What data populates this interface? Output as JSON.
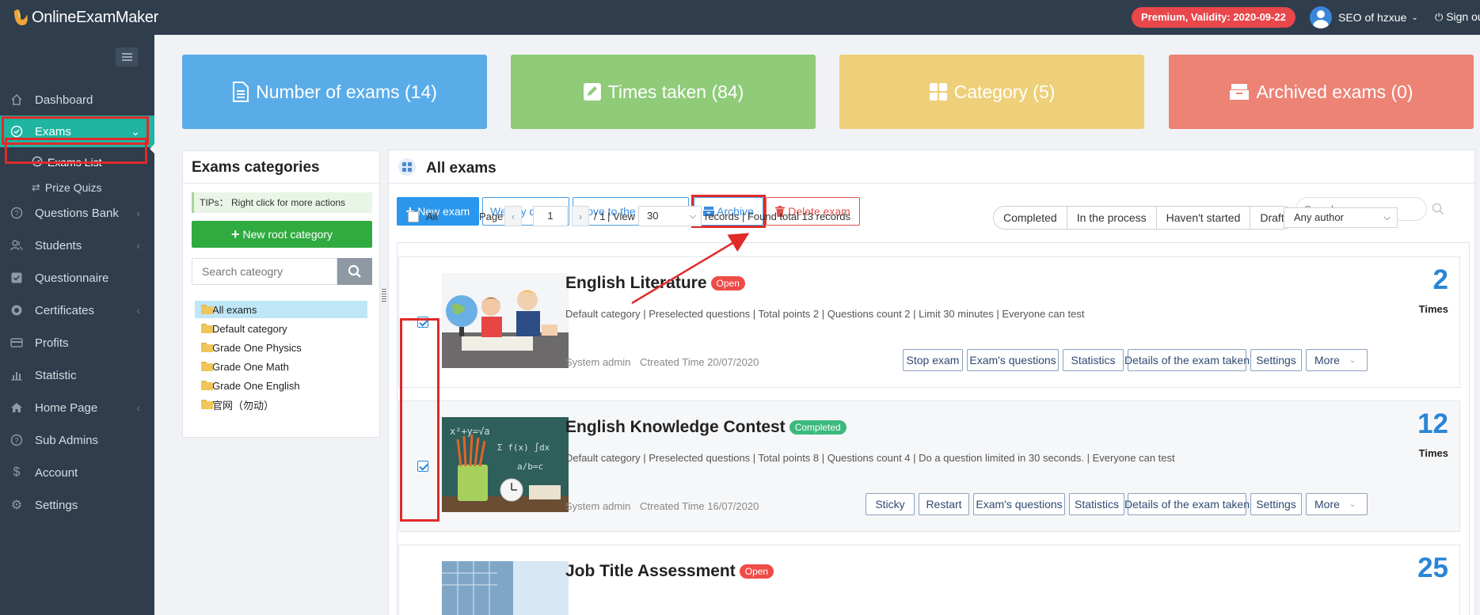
{
  "app": {
    "logo_text": "OnlineExamMaker"
  },
  "header": {
    "premium_badge": "Premium, Validity: 2020-09-22",
    "user_name": "SEO of hzxue",
    "signout_label": "Sign out"
  },
  "sidebar": {
    "items": [
      {
        "label": "Dashboard",
        "icon": "home-icon"
      },
      {
        "label": "Exams",
        "icon": "check-circle-icon"
      },
      {
        "label": "Questions Bank",
        "icon": "question-circle-icon"
      },
      {
        "label": "Students",
        "icon": "users-icon"
      },
      {
        "label": "Questionnaire",
        "icon": "check-square-icon"
      },
      {
        "label": "Certificates",
        "icon": "certificate-icon"
      },
      {
        "label": "Profits",
        "icon": "credit-card-icon"
      },
      {
        "label": "Statistic",
        "icon": "bar-chart-icon"
      },
      {
        "label": "Home Page",
        "icon": "home-page-icon"
      },
      {
        "label": "Sub Admins",
        "icon": "question-icon"
      },
      {
        "label": "Account",
        "icon": "dollar-icon"
      },
      {
        "label": "Settings",
        "icon": "gear-icon"
      }
    ],
    "sub_items": [
      {
        "label": "Exams List",
        "icon": "check-circle-icon"
      },
      {
        "label": "Prize Quizs",
        "icon": "shuffle-icon"
      }
    ]
  },
  "stats": [
    {
      "label": "Number of exams (14)",
      "color": "#5aace8",
      "icon": "document-icon"
    },
    {
      "label": "Times taken (84)",
      "color": "#8fcb79",
      "icon": "edit-icon"
    },
    {
      "label": "Category (5)",
      "color": "#eed07a",
      "icon": "grid-icon"
    },
    {
      "label": "Archived exams (0)",
      "color": "#ec8375",
      "icon": "archive-icon"
    }
  ],
  "categories": {
    "title": "Exams categories",
    "tips": "TIPs： Right click for more actions",
    "new_root_label": "New root category",
    "search_placeholder": "Search cateogry",
    "tree": [
      "All exams",
      "Default category",
      "Grade One Physics",
      "Grade One Math",
      "Grade One English",
      "官网（勿动）"
    ]
  },
  "exams_panel": {
    "title": "All exams",
    "toolbar": {
      "new_exam": "New exam",
      "weekly_details": "Weekly details",
      "move_category": "Move to the Category",
      "archive": "Archive",
      "delete_exam": "Delete exam"
    },
    "search_placeholder": "Search",
    "select_all_label": "All",
    "pager": {
      "page_label": "Page",
      "page_value": "1",
      "total_pages": "/ 1",
      "view_label": "| View",
      "view_value": "30",
      "records_text": "records | Found total 13 records"
    },
    "status_filters": [
      "Completed",
      "In the process",
      "Haven't started",
      "Draft"
    ],
    "author_filter": "Any author"
  },
  "exams": [
    {
      "title": "English Literature",
      "status": "Open",
      "status_color": "#ef4b47",
      "meta": "Default category | Preselected questions | Total points 2 | Questions count 2 | Limit 30 minutes | Everyone can test",
      "author": "System admin",
      "created": "Ctreated Time 20/07/2020",
      "count": "2",
      "times_label": "Times",
      "checked": true,
      "actions": [
        "Stop exam",
        "Exam's questions",
        "Statistics",
        "Details of the exam taken",
        "Settings",
        "More"
      ]
    },
    {
      "title": "English Knowledge Contest",
      "status": "Completed",
      "status_color": "#3cb97c",
      "meta": "Default category | Preselected questions | Total points 8 | Questions count 4 | Do a question limited in 30 seconds. | Everyone can test",
      "author": "System admin",
      "created": "Ctreated Time 16/07/2020",
      "count": "12",
      "times_label": "Times",
      "checked": true,
      "actions": [
        "Sticky",
        "Restart",
        "Exam's questions",
        "Statistics",
        "Details of the exam taken",
        "Settings",
        "More"
      ]
    },
    {
      "title": "Job Title Assessment",
      "status": "Open",
      "status_color": "#ef4b47",
      "count": "25"
    }
  ]
}
